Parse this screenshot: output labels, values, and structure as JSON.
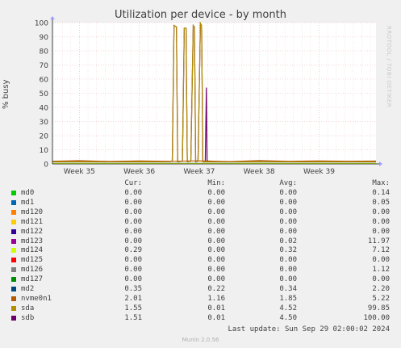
{
  "title": "Utilization per device - by month",
  "side_label": "RRDTOOL / TOBI OETIKER",
  "footer": {
    "last_update": "Last update: Sun Sep 29 02:00:02 2024",
    "munin": "Munin 2.0.56"
  },
  "legend_headers": {
    "cur": "Cur:",
    "min": "Min:",
    "avg": "Avg:",
    "max": "Max:"
  },
  "legend": [
    {
      "name": "md0",
      "color": "#00cc00",
      "cur": "0.00",
      "min": "0.00",
      "avg": "0.00",
      "max": "0.14"
    },
    {
      "name": "md1",
      "color": "#0066b3",
      "cur": "0.00",
      "min": "0.00",
      "avg": "0.00",
      "max": "0.05"
    },
    {
      "name": "md120",
      "color": "#ff8000",
      "cur": "0.00",
      "min": "0.00",
      "avg": "0.00",
      "max": "0.00"
    },
    {
      "name": "md121",
      "color": "#ffcc00",
      "cur": "0.00",
      "min": "0.00",
      "avg": "0.00",
      "max": "0.00"
    },
    {
      "name": "md122",
      "color": "#330099",
      "cur": "0.00",
      "min": "0.00",
      "avg": "0.00",
      "max": "0.00"
    },
    {
      "name": "md123",
      "color": "#990099",
      "cur": "0.00",
      "min": "0.00",
      "avg": "0.02",
      "max": "11.97"
    },
    {
      "name": "md124",
      "color": "#ccff00",
      "cur": "0.29",
      "min": "0.00",
      "avg": "0.32",
      "max": "7.12"
    },
    {
      "name": "md125",
      "color": "#ff0000",
      "cur": "0.00",
      "min": "0.00",
      "avg": "0.00",
      "max": "0.00"
    },
    {
      "name": "md126",
      "color": "#808080",
      "cur": "0.00",
      "min": "0.00",
      "avg": "0.00",
      "max": "1.12"
    },
    {
      "name": "md127",
      "color": "#008f00",
      "cur": "0.00",
      "min": "0.00",
      "avg": "0.00",
      "max": "0.00"
    },
    {
      "name": "md2",
      "color": "#00487d",
      "cur": "0.35",
      "min": "0.22",
      "avg": "0.34",
      "max": "2.20"
    },
    {
      "name": "nvme0n1",
      "color": "#b35a00",
      "cur": "2.01",
      "min": "1.16",
      "avg": "1.85",
      "max": "5.22"
    },
    {
      "name": "sda",
      "color": "#b38f00",
      "cur": "1.55",
      "min": "0.01",
      "avg": "4.52",
      "max": "99.85"
    },
    {
      "name": "sdb",
      "color": "#6b006b",
      "cur": "1.51",
      "min": "0.01",
      "avg": "4.50",
      "max": "100.00"
    }
  ],
  "chart_data": {
    "type": "line",
    "title": "Utilization per device - by month",
    "ylabel": "% busy",
    "xlabel": "",
    "ylim": [
      0,
      100
    ],
    "yticks": [
      "0",
      "10",
      "20",
      "30",
      "40",
      "50",
      "60",
      "70",
      "80",
      "90",
      "100"
    ],
    "xlim_weeks": [
      34.55,
      39.95
    ],
    "xticks": [
      {
        "label": "Week 35",
        "pos": 35
      },
      {
        "label": "Week 36",
        "pos": 36
      },
      {
        "label": "Week 37",
        "pos": 37
      },
      {
        "label": "Week 38",
        "pos": 38
      },
      {
        "label": "Week 39",
        "pos": 39
      }
    ],
    "grid": true,
    "series": [
      {
        "name": "sdb",
        "color": "#6b006b",
        "points": [
          [
            34.55,
            1.5
          ],
          [
            36.5,
            1.5
          ],
          [
            36.55,
            2
          ],
          [
            36.58,
            98
          ],
          [
            36.62,
            97
          ],
          [
            36.64,
            1.5
          ],
          [
            36.72,
            2
          ],
          [
            36.75,
            96
          ],
          [
            36.78,
            96
          ],
          [
            36.8,
            1.5
          ],
          [
            36.86,
            2
          ],
          [
            36.9,
            98
          ],
          [
            36.92,
            97
          ],
          [
            36.94,
            1.5
          ],
          [
            36.98,
            2
          ],
          [
            37.02,
            99.5
          ],
          [
            37.04,
            98
          ],
          [
            37.06,
            1.5
          ],
          [
            37.1,
            1.5
          ],
          [
            37.12,
            54
          ],
          [
            37.13,
            3
          ],
          [
            37.15,
            1.5
          ],
          [
            39.95,
            1.5
          ]
        ]
      },
      {
        "name": "sda",
        "color": "#b38f00",
        "points": [
          [
            34.55,
            1.5
          ],
          [
            36.5,
            1.5
          ],
          [
            36.55,
            2
          ],
          [
            36.58,
            98
          ],
          [
            36.62,
            97
          ],
          [
            36.64,
            1.5
          ],
          [
            36.72,
            2
          ],
          [
            36.75,
            96
          ],
          [
            36.78,
            96
          ],
          [
            36.8,
            1.5
          ],
          [
            36.86,
            2
          ],
          [
            36.9,
            98
          ],
          [
            36.92,
            97
          ],
          [
            36.94,
            1.5
          ],
          [
            36.98,
            2
          ],
          [
            37.02,
            99.5
          ],
          [
            37.04,
            98
          ],
          [
            37.06,
            1.5
          ],
          [
            39.95,
            1.5
          ]
        ]
      },
      {
        "name": "nvme0n1",
        "color": "#b35a00",
        "points": [
          [
            34.55,
            1.9
          ],
          [
            35.0,
            2.3
          ],
          [
            35.5,
            1.7
          ],
          [
            36.0,
            2.1
          ],
          [
            36.5,
            1.8
          ],
          [
            37.0,
            2.2
          ],
          [
            37.5,
            1.6
          ],
          [
            38.0,
            2.4
          ],
          [
            38.5,
            1.8
          ],
          [
            39.0,
            2.1
          ],
          [
            39.5,
            1.9
          ],
          [
            39.95,
            2.0
          ]
        ]
      },
      {
        "name": "md2",
        "color": "#00487d",
        "points": [
          [
            34.55,
            0.4
          ],
          [
            39.95,
            0.35
          ]
        ]
      },
      {
        "name": "md124",
        "color": "#ccff00",
        "points": [
          [
            34.55,
            0.3
          ],
          [
            39.95,
            0.3
          ]
        ]
      }
    ]
  }
}
